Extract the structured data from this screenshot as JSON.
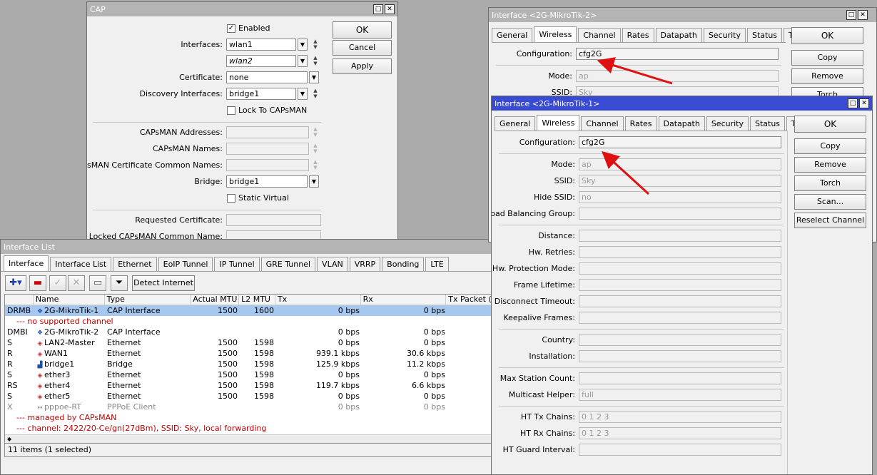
{
  "cap": {
    "title": "CAP",
    "enabled_label": "Enabled",
    "interfaces_label": "Interfaces:",
    "interface1": "wlan1",
    "interface2": "wlan2",
    "certificate_label": "Certificate:",
    "certificate": "none",
    "discovery_label": "Discovery Interfaces:",
    "discovery": "bridge1",
    "lock_label": "Lock To CAPsMAN",
    "addresses_label": "CAPsMAN Addresses:",
    "names_label": "CAPsMAN Names:",
    "cert_cn_label": "CAPsMAN Certificate Common Names:",
    "bridge_label": "Bridge:",
    "bridge": "bridge1",
    "static_virtual_label": "Static Virtual",
    "requested_cert_label": "Requested Certificate:",
    "locked_cn_label": "Locked CAPsMAN Common Name:",
    "ok": "OK",
    "cancel": "Cancel",
    "apply": "Apply"
  },
  "iflist": {
    "title": "Interface List",
    "tabs": [
      "Interface",
      "Interface List",
      "Ethernet",
      "EoIP Tunnel",
      "IP Tunnel",
      "GRE Tunnel",
      "VLAN",
      "VRRP",
      "Bonding",
      "LTE"
    ],
    "detect": "Detect Internet",
    "columns": [
      "",
      "Name",
      "Type",
      "Actual MTU",
      "L2 MTU",
      "Tx",
      "Rx",
      "Tx Packet (p"
    ],
    "rows": [
      {
        "flags": "DRMB",
        "name": "2G-MikroTik-1",
        "type": "CAP Interface",
        "mtu": "1500",
        "l2": "1600",
        "tx": "0 bps",
        "rx": "0 bps"
      },
      {
        "comment": "--- no supported channel"
      },
      {
        "flags": "DMBI",
        "name": "2G-MikroTik-2",
        "type": "CAP Interface",
        "mtu": "",
        "l2": "",
        "tx": "0 bps",
        "rx": "0 bps"
      },
      {
        "flags": "S",
        "name": "LAN2-Master",
        "type": "Ethernet",
        "mtu": "1500",
        "l2": "1598",
        "tx": "0 bps",
        "rx": "0 bps"
      },
      {
        "flags": "R",
        "name": "WAN1",
        "type": "Ethernet",
        "mtu": "1500",
        "l2": "1598",
        "tx": "939.1 kbps",
        "rx": "30.6 kbps"
      },
      {
        "flags": "R",
        "name": "bridge1",
        "type": "Bridge",
        "mtu": "1500",
        "l2": "1598",
        "tx": "125.9 kbps",
        "rx": "11.2 kbps"
      },
      {
        "flags": "S",
        "name": "ether3",
        "type": "Ethernet",
        "mtu": "1500",
        "l2": "1598",
        "tx": "0 bps",
        "rx": "0 bps"
      },
      {
        "flags": "RS",
        "name": "ether4",
        "type": "Ethernet",
        "mtu": "1500",
        "l2": "1598",
        "tx": "119.7 kbps",
        "rx": "6.6 kbps"
      },
      {
        "flags": "S",
        "name": "ether5",
        "type": "Ethernet",
        "mtu": "1500",
        "l2": "1598",
        "tx": "0 bps",
        "rx": "0 bps"
      },
      {
        "flags": "X",
        "name": "pppoe-RT",
        "type": "PPPoE Client",
        "mtu": "",
        "l2": "",
        "tx": "0 bps",
        "rx": "0 bps"
      },
      {
        "comment": "--- managed by CAPsMAN"
      },
      {
        "comment": "--- channel: 2422/20-Ce/gn(27dBm), SSID: Sky, local forwarding"
      }
    ],
    "status": "11 items (1 selected)"
  },
  "iface2": {
    "title": "Interface <2G-MikroTik-2>",
    "tabs": [
      "General",
      "Wireless",
      "Channel",
      "Rates",
      "Datapath",
      "Security",
      "Status",
      "Traffic"
    ],
    "config_label": "Configuration:",
    "config": "cfg2G",
    "mode_label": "Mode:",
    "mode": "ap",
    "ssid_label": "SSID:",
    "ssid": "Sky",
    "buttons": [
      "OK",
      "Copy",
      "Remove",
      "Torch"
    ]
  },
  "iface1": {
    "title": "Interface <2G-MikroTik-1>",
    "tabs": [
      "General",
      "Wireless",
      "Channel",
      "Rates",
      "Datapath",
      "Security",
      "Status",
      "Traffic"
    ],
    "fields": [
      {
        "label": "Configuration:",
        "value": "cfg2G"
      },
      {
        "label": "Mode:",
        "value": "ap"
      },
      {
        "label": "SSID:",
        "value": "Sky"
      },
      {
        "label": "Hide SSID:",
        "value": "no"
      },
      {
        "label": "Load Balancing Group:",
        "value": ""
      },
      {
        "label": "Distance:",
        "value": ""
      },
      {
        "label": "Hw. Retries:",
        "value": ""
      },
      {
        "label": "Hw. Protection Mode:",
        "value": ""
      },
      {
        "label": "Frame Lifetime:",
        "value": ""
      },
      {
        "label": "Disconnect Timeout:",
        "value": ""
      },
      {
        "label": "Keepalive Frames:",
        "value": ""
      },
      {
        "label": "Country:",
        "value": ""
      },
      {
        "label": "Installation:",
        "value": ""
      },
      {
        "label": "Max Station Count:",
        "value": ""
      },
      {
        "label": "Multicast Helper:",
        "value": "full"
      },
      {
        "label": "HT Tx Chains:",
        "value": "0 1 2 3"
      },
      {
        "label": "HT Rx Chains:",
        "value": "0 1 2 3"
      },
      {
        "label": "HT Guard Interval:",
        "value": ""
      }
    ],
    "buttons": [
      "OK",
      "Copy",
      "Remove",
      "Torch",
      "Scan...",
      "Reselect Channel"
    ]
  },
  "colors": {
    "active_title": "#3a4bd3",
    "inactive_title": "#b4b4b4",
    "arrow": "#e01010",
    "selection": "#a6c8ee",
    "comment": "#c00000"
  }
}
